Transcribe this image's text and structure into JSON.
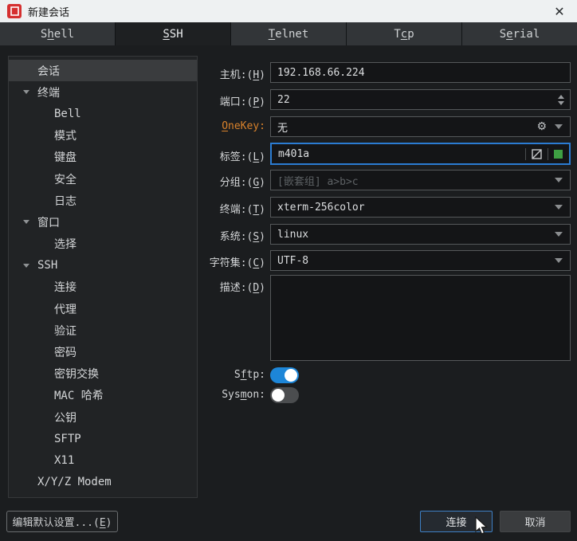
{
  "window": {
    "title": "新建会话",
    "close_icon": "✕"
  },
  "tabs": [
    {
      "pre": "S",
      "key": "h",
      "post": "ell"
    },
    {
      "pre": "",
      "key": "S",
      "post": "SH"
    },
    {
      "pre": "",
      "key": "T",
      "post": "elnet"
    },
    {
      "pre": "T",
      "key": "c",
      "post": "p"
    },
    {
      "pre": "S",
      "key": "e",
      "post": "rial"
    }
  ],
  "active_tab": "SSH",
  "sidebar": {
    "items": [
      {
        "label": "会话"
      },
      {
        "label": "终端"
      },
      {
        "label": "Bell"
      },
      {
        "label": "模式"
      },
      {
        "label": "键盘"
      },
      {
        "label": "安全"
      },
      {
        "label": "日志"
      },
      {
        "label": "窗口"
      },
      {
        "label": "选择"
      },
      {
        "label": "SSH"
      },
      {
        "label": "连接"
      },
      {
        "label": "代理"
      },
      {
        "label": "验证"
      },
      {
        "label": "密码"
      },
      {
        "label": "密钥交换"
      },
      {
        "label": "MAC 哈希"
      },
      {
        "label": "公钥"
      },
      {
        "label": "SFTP"
      },
      {
        "label": "X11"
      },
      {
        "label": "X/Y/Z Modem"
      }
    ],
    "selected_item": "会话"
  },
  "form": {
    "host": {
      "label_pre": "主机:(",
      "label_key": "H",
      "label_post": ")",
      "value": "192.168.66.224"
    },
    "port": {
      "label_pre": "端口:(",
      "label_key": "P",
      "label_post": ")",
      "value": "22"
    },
    "onekey": {
      "label_pre": "",
      "label_key": "O",
      "label_post": "neKey:",
      "value": "无"
    },
    "tag": {
      "label_pre": "标签:(",
      "label_key": "L",
      "label_post": ")",
      "value": "m401a",
      "swatch_color": "#3ea043"
    },
    "group": {
      "label_pre": "分组:(",
      "label_key": "G",
      "label_post": ")",
      "placeholder": "[嵌套组] a>b>c"
    },
    "term": {
      "label_pre": "终端:(",
      "label_key": "T",
      "label_post": ")",
      "value": "xterm-256color"
    },
    "system": {
      "label_pre": "系统:(",
      "label_key": "S",
      "label_post": ")",
      "value": "linux"
    },
    "charset": {
      "label_pre": "字符集:(",
      "label_key": "C",
      "label_post": ")",
      "value": "UTF-8"
    },
    "description": {
      "label_pre": "描述:(",
      "label_key": "D",
      "label_post": ")",
      "value": ""
    },
    "sftp": {
      "label_pre": "S",
      "label_key": "f",
      "label_post": "tp:",
      "state": "on"
    },
    "sysmon": {
      "label_pre": "Sys",
      "label_key": "m",
      "label_post": "on:",
      "state": "off"
    }
  },
  "footer": {
    "edit_defaults": {
      "pre": "编辑默认设置...(",
      "key": "E",
      "post": ")"
    },
    "connect_label": "连接",
    "cancel_label": "取消"
  },
  "colors": {
    "accent_blue": "#2b7cd3",
    "onekey_orange": "#d9822b",
    "toggle_on_blue": "#1d86d8",
    "tag_swatch_green": "#3ea043",
    "app_icon_red": "#d53030",
    "titlebar_bg": "#eef1f2",
    "content_bg": "#1b1d1f"
  }
}
